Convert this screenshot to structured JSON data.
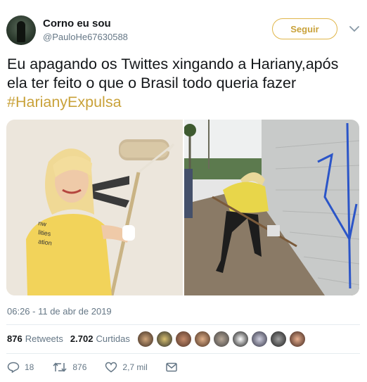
{
  "user": {
    "name": "Corno eu sou",
    "handle": "@PauloHe67630588"
  },
  "follow_label": "Seguir",
  "tweet": {
    "text": "Eu apagando os Twittes xingando a Hariany,após ela ter feito o que o Brasil todo queria fazer ",
    "hashtag": "#HarianyExpulsa"
  },
  "timestamp": "06:26 - 11 de abr de 2019",
  "stats": {
    "retweets_count": "876",
    "retweets_label": "Retweets",
    "likes_count": "2.702",
    "likes_label": "Curtidas"
  },
  "actions": {
    "replies": "18",
    "retweets": "876",
    "likes": "2,7 mil"
  },
  "colors": {
    "accent": "#c9a23a",
    "text": "#14171a",
    "muted": "#657786"
  },
  "likers": [
    "liker-1",
    "liker-2",
    "liker-3",
    "liker-4",
    "liker-5",
    "liker-6",
    "liker-7",
    "liker-8",
    "liker-9"
  ]
}
